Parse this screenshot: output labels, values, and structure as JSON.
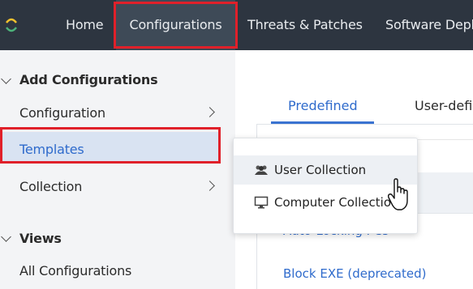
{
  "topnav": {
    "items": [
      {
        "label": "Home"
      },
      {
        "label": "Configurations",
        "active": true
      },
      {
        "label": "Threats & Patches"
      },
      {
        "label": "Software Depl"
      }
    ]
  },
  "sidebar": {
    "add_section": {
      "heading": "Add Configurations",
      "items": [
        {
          "label": "Configuration",
          "has_submenu": true
        },
        {
          "label": "Templates",
          "selected": true
        },
        {
          "label": "Collection",
          "has_submenu": true
        }
      ]
    },
    "views_section": {
      "heading": "Views",
      "items": [
        {
          "label": "All Configurations"
        }
      ]
    }
  },
  "main": {
    "tabs": [
      {
        "label": "Predefined",
        "active": true
      },
      {
        "label": "User-defi"
      }
    ],
    "list": [
      {
        "label": "Auto-Locking PCs"
      },
      {
        "label": "Block EXE (deprecated)"
      }
    ]
  },
  "popup": {
    "items": [
      {
        "label": "User Collection",
        "icon": "users-icon"
      },
      {
        "label": "Computer Collectio",
        "icon": "monitor-icon"
      }
    ]
  },
  "colors": {
    "topbar": "#2d3540",
    "active_nav": "#3e4a57",
    "highlight_box": "#e0202a",
    "link": "#2f6bcc",
    "tab_underline": "#3a73d1",
    "selected_row": "#d9e3f2"
  }
}
